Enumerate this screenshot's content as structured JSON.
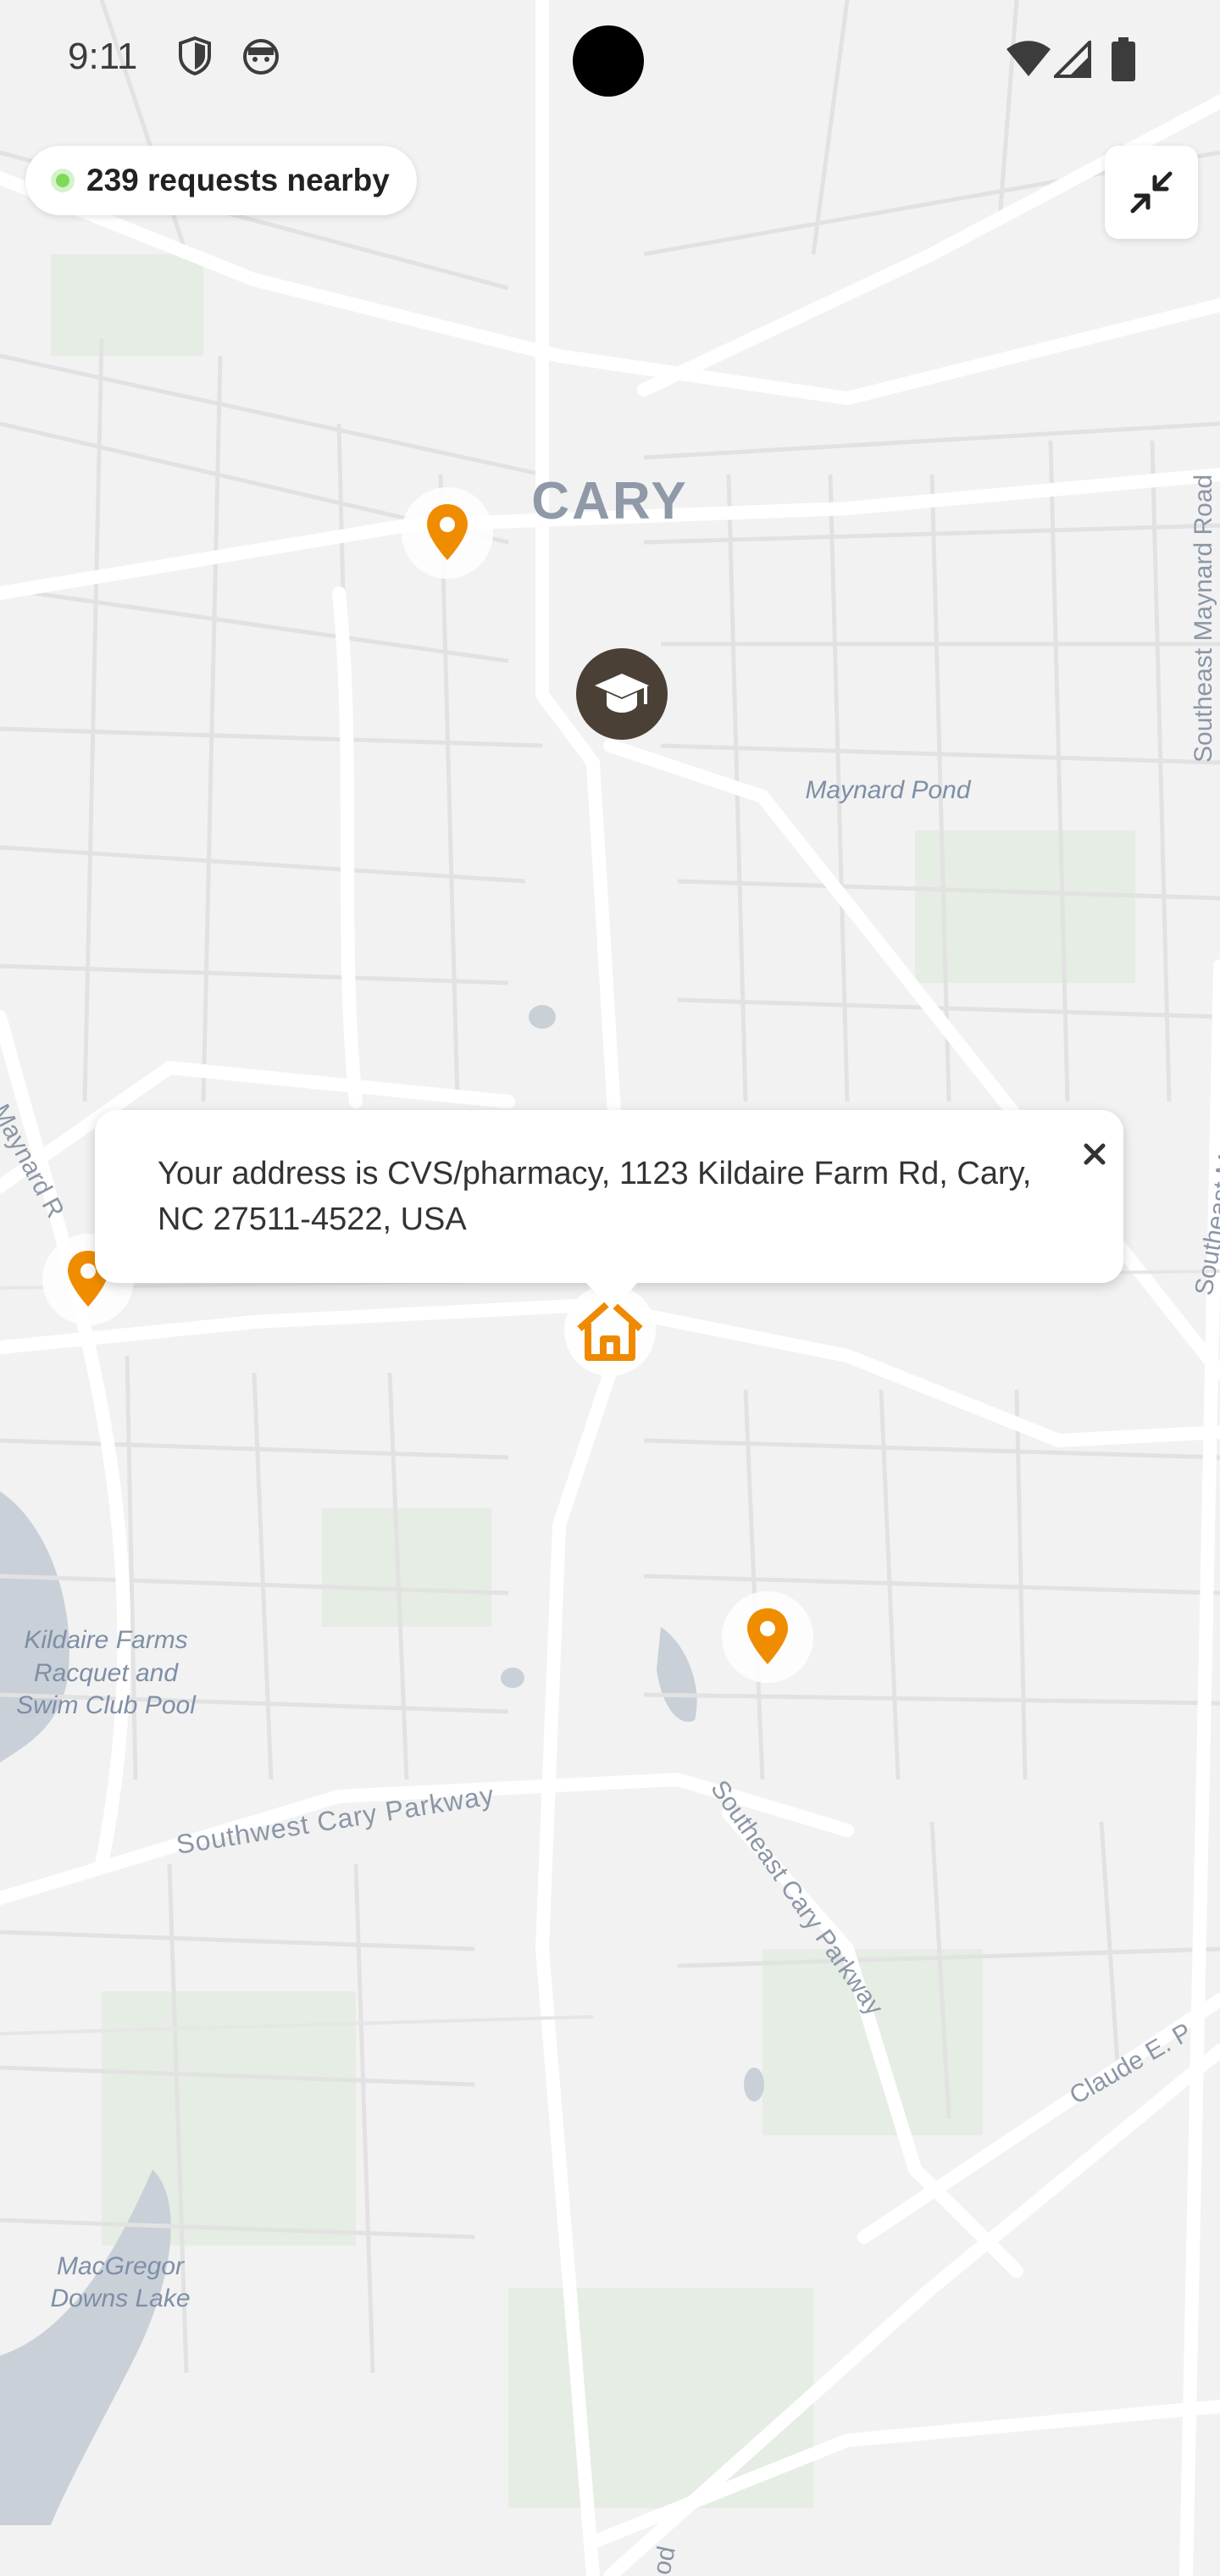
{
  "status_bar": {
    "time": "9:11",
    "icons": [
      "shield-icon",
      "face-icon",
      "wifi-icon",
      "signal-icon",
      "battery-icon"
    ]
  },
  "requests": {
    "count_text": "239 requests nearby",
    "dot_color": "#7ed957"
  },
  "collapse_button": {
    "icon": "collapse-arrows-icon"
  },
  "map": {
    "background": "#f2f2f2",
    "road_color": "#ffffff",
    "label_color": "#8b96a6",
    "labels": {
      "city": "CARY",
      "pond": "Maynard Pond",
      "se_maynard_top": "Southeast Maynard Road",
      "se_maynard_right": "Southeast Maynard Road",
      "maynard_left": "Maynard R",
      "kildaire1": "Kildaire Farms",
      "kildaire2": "Racquet and",
      "kildaire3": "Swim Club Pool",
      "sw_parkway": "Southwest Cary Parkway",
      "se_parkway": "Southeast Cary Parkway",
      "claude": "Claude E. P",
      "macgregor1": "MacGregor",
      "macgregor2": "Downs Lake",
      "bottom_road": "od"
    }
  },
  "markers": {
    "pin_color": "#f08c00",
    "school_color": "#4a4036",
    "home_color": "#ef8a00",
    "items": [
      {
        "type": "pin",
        "icon": "location-pin-icon"
      },
      {
        "type": "school",
        "icon": "graduation-cap-icon"
      },
      {
        "type": "pin",
        "icon": "location-pin-icon"
      },
      {
        "type": "home",
        "icon": "home-icon"
      },
      {
        "type": "pin",
        "icon": "location-pin-icon"
      }
    ]
  },
  "popup": {
    "text": "Your address is CVS/pharmacy, 1123 Kildaire Farm Rd, Cary, NC 27511-4522, USA",
    "close_icon": "close-icon"
  }
}
